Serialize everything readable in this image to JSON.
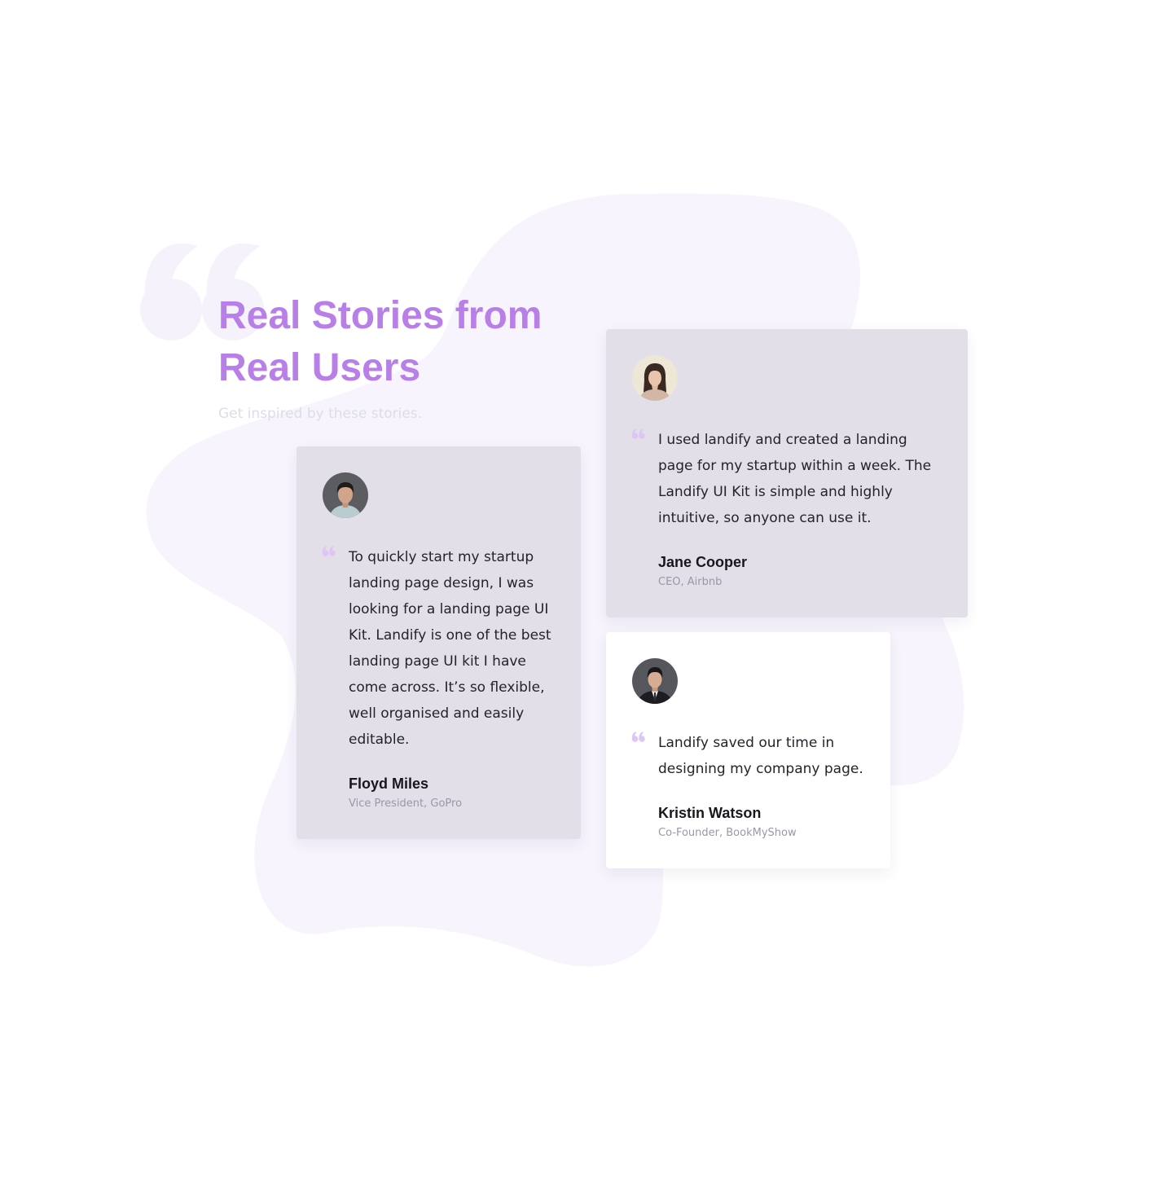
{
  "header": {
    "title_line_1": "Real Stories from",
    "title_line_2": "Real Users",
    "subtitle": "Get inspired by these stories."
  },
  "colors": {
    "accent": "#b97fe9",
    "blob": "#f7f4fd",
    "card_shaded": "#e3dfe8",
    "quote_mark": "#ddc6f4"
  },
  "testimonials": [
    {
      "quote": "To quickly start my startup landing page design, I was looking for a landing page UI Kit. Landify is one of the best landing page UI kit I have come across. It’s so flexible, well organised and easily editable.",
      "name": "Floyd Miles",
      "role": "Vice President, GoPro",
      "avatar_icon": "man-portrait-avatar"
    },
    {
      "quote": "I used landify and created a landing page for my startup within a week. The Landify UI Kit is simple and highly intuitive, so anyone can use it.",
      "name": "Jane Cooper",
      "role": "CEO, Airbnb",
      "avatar_icon": "woman-portrait-avatar"
    },
    {
      "quote": "Landify saved our time in designing my company page.",
      "name": "Kristin Watson",
      "role": "Co-Founder, BookMyShow",
      "avatar_icon": "man-in-suit-portrait-avatar"
    }
  ]
}
